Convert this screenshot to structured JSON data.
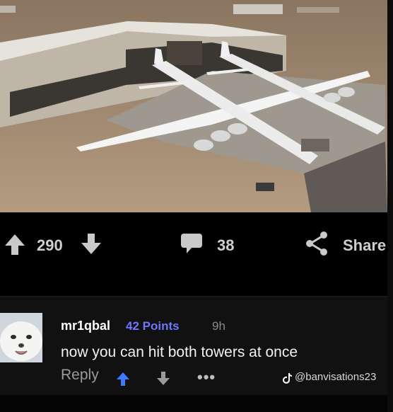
{
  "post": {
    "image_alt": "Large twin-fuselage aircraft parked outside a hangar",
    "upvotes": "290",
    "comments": "38",
    "share_label": "Share"
  },
  "comment": {
    "username": "mr1qbal",
    "points": "42 Points",
    "time": "9h",
    "text": "now you can hit both towers at once",
    "reply_label": "Reply",
    "more_label": "•••"
  },
  "watermark": "@banvisations23",
  "icons": {
    "upvote": "arrow-up-icon",
    "downvote": "arrow-down-icon",
    "comment": "speech-bubble-icon",
    "share": "share-icon",
    "tiktok": "tiktok-icon"
  },
  "colors": {
    "background": "#000000",
    "comment_bg": "#111111",
    "points": "#6d78ff",
    "upvote_active": "#3d7bff"
  }
}
